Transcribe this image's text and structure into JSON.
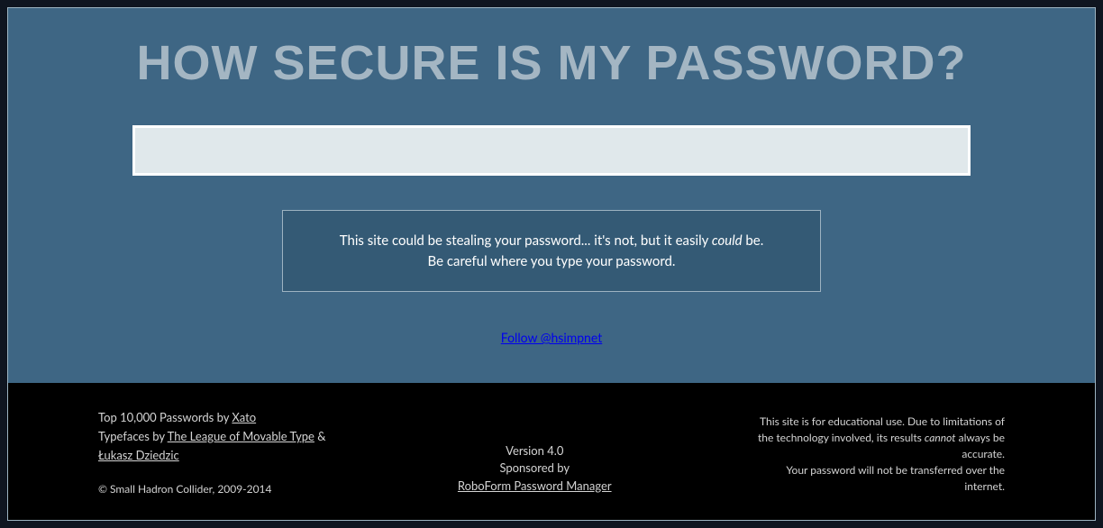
{
  "title": "HOW SECURE IS MY PASSWORD?",
  "password_value": "",
  "warning": {
    "line1_pre": "This site could be stealing your password... it's not, but it easily ",
    "line1_em": "could",
    "line1_post": " be.",
    "line2": "Be careful where you type your password."
  },
  "follow_link": "Follow @hsimpnet",
  "footer": {
    "left": {
      "passwords_pre": "Top 10,000 Passwords by ",
      "passwords_link": "Xato",
      "typefaces_pre": "Typefaces by ",
      "typefaces_link1": "The League of Movable Type",
      "typefaces_amp": " & ",
      "typefaces_link2": "Łukasz Dziedzic",
      "copyright": "© Small Hadron Collider, 2009-2014"
    },
    "center": {
      "version": "Version 4.0",
      "sponsored_by": "Sponsored by",
      "sponsor_link": "RoboForm Password Manager"
    },
    "right": {
      "line_pre": "This site is for educational use. Due to limitations of the technology involved, its results ",
      "line_em": "cannot",
      "line_post": " always be accurate.",
      "line2": "Your password will not be transferred over the internet."
    }
  }
}
